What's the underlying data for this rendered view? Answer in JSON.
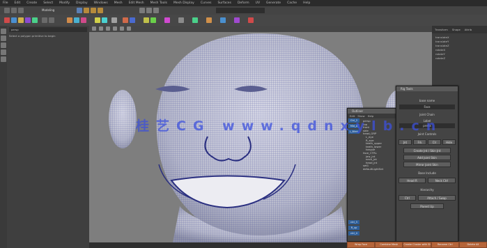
{
  "menubar": {
    "items": [
      "File",
      "Edit",
      "Create",
      "Select",
      "Modify",
      "Display",
      "Windows",
      "Mesh",
      "Edit Mesh",
      "Mesh Tools",
      "Mesh Display",
      "Curves",
      "Surfaces",
      "Deform",
      "UV",
      "Generate",
      "Cache",
      "Help"
    ]
  },
  "window_title": "Modeling",
  "watermark": "桂艺CG www.qdnxylb.cn",
  "colors": {
    "watermark": "#3c50dc",
    "wire": "#2a2f80",
    "skin": "#c9cad8",
    "accent": "#2e5f9a",
    "taskbar": "#b5653a"
  },
  "outliner": {
    "search_text": "persp",
    "line": "Select a polygon primitive to begin"
  },
  "right_panel": {
    "tabs": [
      "Transform",
      "Shape",
      "Attrib"
    ],
    "lines": [
      "translateX",
      "translateY",
      "translateZ",
      "rotateX",
      "rotateY",
      "rotateZ"
    ]
  },
  "dialog": {
    "title": "Rig Tools",
    "field_label": "base name",
    "field_value": "Face",
    "section1": "Joint Chain",
    "input_label": "Label",
    "input_value": "prefix",
    "section2": "Joint Controls",
    "row1": [
      "Jnt",
      "Frk",
      "Clr",
      "Hide"
    ],
    "row2": "Create Jnt / Skin Jnt",
    "row3": "Add Joint Skin",
    "row4": "Mirror Joint Skin",
    "section3": "Base Include",
    "row5": [
      "Head R",
      "Neck Ctrl"
    ],
    "section4": "Hierarchy",
    "row6": [
      "Ctrl",
      "Attach / Swap"
    ],
    "row7": "Parent Up"
  },
  "outliner_win": {
    "title": "Outliner",
    "menu": [
      "Edit",
      "Show",
      "Help"
    ],
    "items": [
      "persp",
      "top",
      "front",
      "side",
      "head_GRP",
      "L_eye",
      "R_eye",
      "teeth_upper",
      "teeth_lower",
      "tongue",
      "face_CTRL",
      "jaw_jnt",
      "neck_jnt",
      "head_jnt",
      "set1",
      "defaultLightSet"
    ]
  },
  "side_items": [
    "Ctrl_2",
    "Mid_A",
    "L_Blink",
    "ctrl_3",
    "R_up",
    "ctrl_4"
  ],
  "taskbar": [
    "Wrap Face",
    "Combine Mesh",
    "Create Cluster with Shape",
    "Rename Ctrl",
    "Delete All"
  ]
}
